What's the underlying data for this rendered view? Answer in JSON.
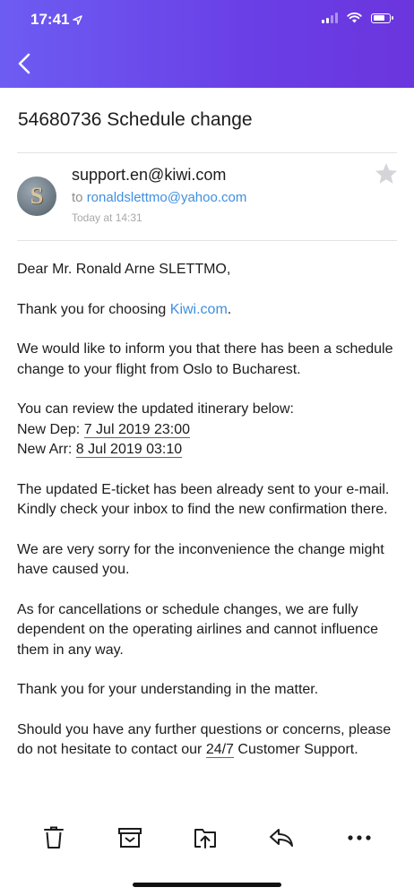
{
  "status_bar": {
    "time": "17:41"
  },
  "message": {
    "subject": "54680736 Schedule change",
    "sender": "support.en@kiwi.com",
    "to_prefix": "to",
    "recipient": "ronaldslettmo@yahoo.com",
    "date": "Today at 14:31",
    "avatar_letter": "S"
  },
  "body": {
    "greeting": "Dear Mr. Ronald Arne SLETTMO,",
    "thanks_prefix": "Thank you for choosing ",
    "thanks_link": "Kiwi.com",
    "thanks_suffix": ".",
    "inform": "We would like to inform you that there has been a schedule change to your flight from Oslo to Bucharest.",
    "review": "You can review the updated itinerary below:",
    "dep_label": "New Dep: ",
    "dep_value": "7 Jul 2019 23:00",
    "arr_label": "New Arr: ",
    "arr_value": "8 Jul 2019 03:10",
    "eticket": "The updated E-ticket has been already sent to your e-mail. Kindly check your inbox to find the new confirmation there.",
    "sorry": "We are very sorry for the inconvenience the change might have caused you.",
    "cancellations": "As for cancellations or schedule changes, we are fully dependent on the operating airlines and cannot influence them in any way.",
    "understanding": "Thank you for your understanding in the matter.",
    "questions_prefix": "Should you have any further questions or concerns, please do not hesitate to contact our ",
    "questions_247": "24/7",
    "questions_suffix": " Customer Support."
  },
  "colors": {
    "header_start": "#6d5cf2",
    "header_end": "#6b35dd",
    "link": "#3f8fe0"
  },
  "icons": {
    "back": "chevron-left-icon",
    "star": "star-icon",
    "delete": "trash-icon",
    "archive": "archive-icon",
    "move": "folder-move-icon",
    "reply": "reply-icon",
    "more": "more-icon"
  }
}
